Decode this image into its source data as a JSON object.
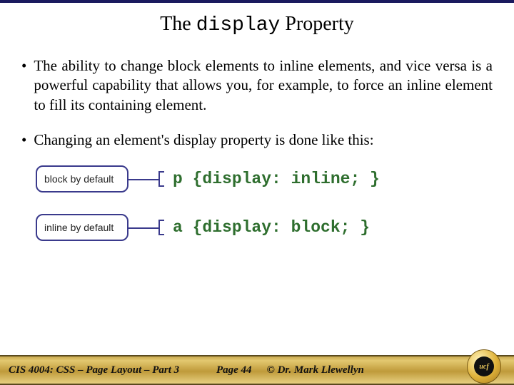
{
  "title": {
    "pre": "The ",
    "code": "display",
    "post": " Property"
  },
  "bullets": [
    "The ability to change block elements to inline elements, and vice versa is a powerful capability that allows you, for example, to force an inline element to fill its containing element.",
    "Changing an element's display property is done like this:"
  ],
  "examples": [
    {
      "label": "block by default",
      "code": "p {display: inline; }"
    },
    {
      "label": "inline by default",
      "code": "a {display: block; }"
    }
  ],
  "footer": {
    "course": "CIS 4004: CSS – Page Layout – Part 3",
    "page": "Page 44",
    "author": "© Dr. Mark Llewellyn"
  },
  "seal_text": "ucf"
}
